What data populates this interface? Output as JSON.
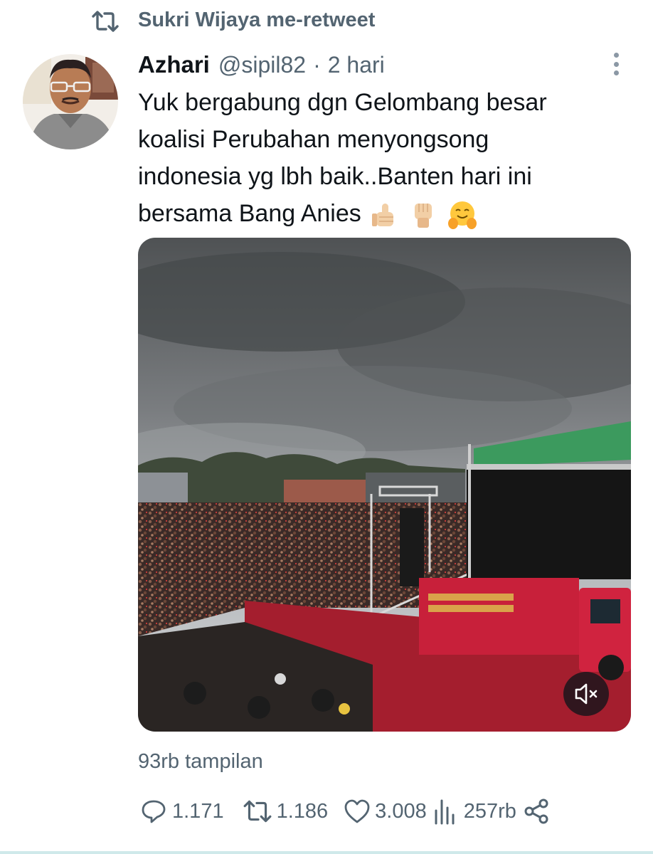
{
  "retweet": {
    "label": "Sukri Wijaya me-retweet"
  },
  "tweet": {
    "author_name": "Azhari",
    "handle": "@sipil82",
    "separator": "·",
    "time": "2 hari",
    "text_lines": [
      "Yuk bergabung dgn Gelombang besar",
      "koalisi Perubahan menyongsong",
      "indonesia yg lbh baik..Banten hari ini",
      "bersama Bang Anies"
    ],
    "emojis": [
      "thumbs-up",
      "raised-fist",
      "hugging-face"
    ],
    "media": {
      "type": "video",
      "muted": true
    },
    "views_label": "93rb tampilan"
  },
  "actions": {
    "replies": "1.171",
    "retweets": "1.186",
    "likes": "3.008",
    "views": "257rb"
  },
  "icons": [
    "retweet-icon",
    "more-icon",
    "mute-icon",
    "reply-icon",
    "like-icon",
    "views-chart-icon",
    "share-icon"
  ],
  "colors": {
    "text": "#0f1419",
    "secondary": "#536471",
    "truck_red": "#c8203a",
    "stage_roof": "#3c9a5e"
  }
}
